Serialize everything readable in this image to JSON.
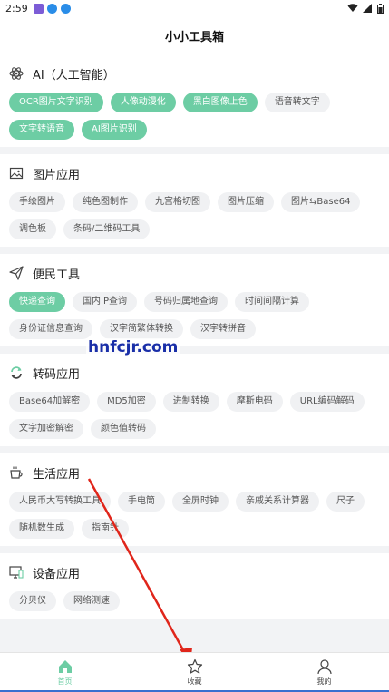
{
  "status": {
    "time": "2:59"
  },
  "app": {
    "title": "小小工具箱"
  },
  "sections": [
    {
      "key": "ai",
      "icon": "atom-icon",
      "title": "AI（人工智能）",
      "items": [
        {
          "label": "OCR图片文字识别",
          "active": true
        },
        {
          "label": "人像动漫化",
          "active": true
        },
        {
          "label": "黑白图像上色",
          "active": true
        },
        {
          "label": "语音转文字",
          "active": false
        },
        {
          "label": "文字转语音",
          "active": true
        },
        {
          "label": "AI图片识别",
          "active": true
        }
      ]
    },
    {
      "key": "image",
      "icon": "image-icon",
      "title": "图片应用",
      "items": [
        {
          "label": "手绘图片",
          "active": false
        },
        {
          "label": "纯色图制作",
          "active": false
        },
        {
          "label": "九宫格切图",
          "active": false
        },
        {
          "label": "图片压缩",
          "active": false
        },
        {
          "label": "图片⇆Base64",
          "active": false
        },
        {
          "label": "调色板",
          "active": false
        },
        {
          "label": "条码/二维码工具",
          "active": false
        }
      ]
    },
    {
      "key": "convenience",
      "icon": "paper-plane-icon",
      "title": "便民工具",
      "items": [
        {
          "label": "快递查询",
          "active": true
        },
        {
          "label": "国内IP查询",
          "active": false
        },
        {
          "label": "号码归属地查询",
          "active": false
        },
        {
          "label": "时间间隔计算",
          "active": false
        },
        {
          "label": "身份证信息查询",
          "active": false
        },
        {
          "label": "汉字简繁体转换",
          "active": false
        },
        {
          "label": "汉字转拼音",
          "active": false
        }
      ]
    },
    {
      "key": "encode",
      "icon": "refresh-icon",
      "title": "转码应用",
      "items": [
        {
          "label": "Base64加解密",
          "active": false
        },
        {
          "label": "MD5加密",
          "active": false
        },
        {
          "label": "进制转换",
          "active": false
        },
        {
          "label": "摩斯电码",
          "active": false
        },
        {
          "label": "URL编码解码",
          "active": false
        },
        {
          "label": "文字加密解密",
          "active": false
        },
        {
          "label": "颜色值转码",
          "active": false
        }
      ]
    },
    {
      "key": "life",
      "icon": "coffee-cup-icon",
      "title": "生活应用",
      "items": [
        {
          "label": "人民币大写转换工具",
          "active": false
        },
        {
          "label": "手电筒",
          "active": false
        },
        {
          "label": "全屏时钟",
          "active": false
        },
        {
          "label": "亲戚关系计算器",
          "active": false
        },
        {
          "label": "尺子",
          "active": false
        },
        {
          "label": "随机数生成",
          "active": false
        },
        {
          "label": "指南针",
          "active": false
        }
      ]
    },
    {
      "key": "device",
      "icon": "monitor-icon",
      "title": "设备应用",
      "items": [
        {
          "label": "分贝仪",
          "active": false
        },
        {
          "label": "网络测速",
          "active": false
        }
      ]
    }
  ],
  "tabs": [
    {
      "label": "首页",
      "icon": "home-icon",
      "active": true
    },
    {
      "label": "收藏",
      "icon": "star-icon",
      "active": false
    },
    {
      "label": "我的",
      "icon": "user-icon",
      "active": false
    }
  ],
  "watermark": "hnfcjr.com",
  "colors": {
    "accent": "#6dcda4",
    "arrow": "#e0261b"
  }
}
